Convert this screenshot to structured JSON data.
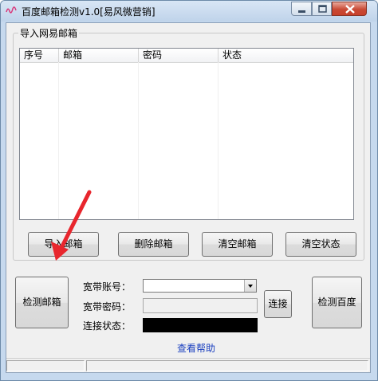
{
  "window": {
    "title": "百度邮箱检测v1.0[易风微营销]"
  },
  "import_group": {
    "legend": "导入网易邮箱",
    "columns": [
      "序号",
      "邮箱",
      "密码",
      "状态"
    ],
    "rows": []
  },
  "buttons": {
    "import": "导入邮箱",
    "delete": "删除邮箱",
    "clear_mail": "清空邮箱",
    "clear_status": "清空状态",
    "check_mail": "检测邮箱",
    "connect": "连接",
    "check_baidu": "检测百度"
  },
  "form": {
    "account_label": "宽带账号：",
    "account_value": "",
    "password_label": "宽带密码：",
    "password_value": "",
    "status_label": "连接状态："
  },
  "help_link": "查看帮助",
  "colors": {
    "titlebar": "#c6d9ee",
    "close_button": "#c7402b",
    "help_link": "#1a3fbf",
    "status_indicator": "#000000",
    "arrow": "#e8262d"
  }
}
